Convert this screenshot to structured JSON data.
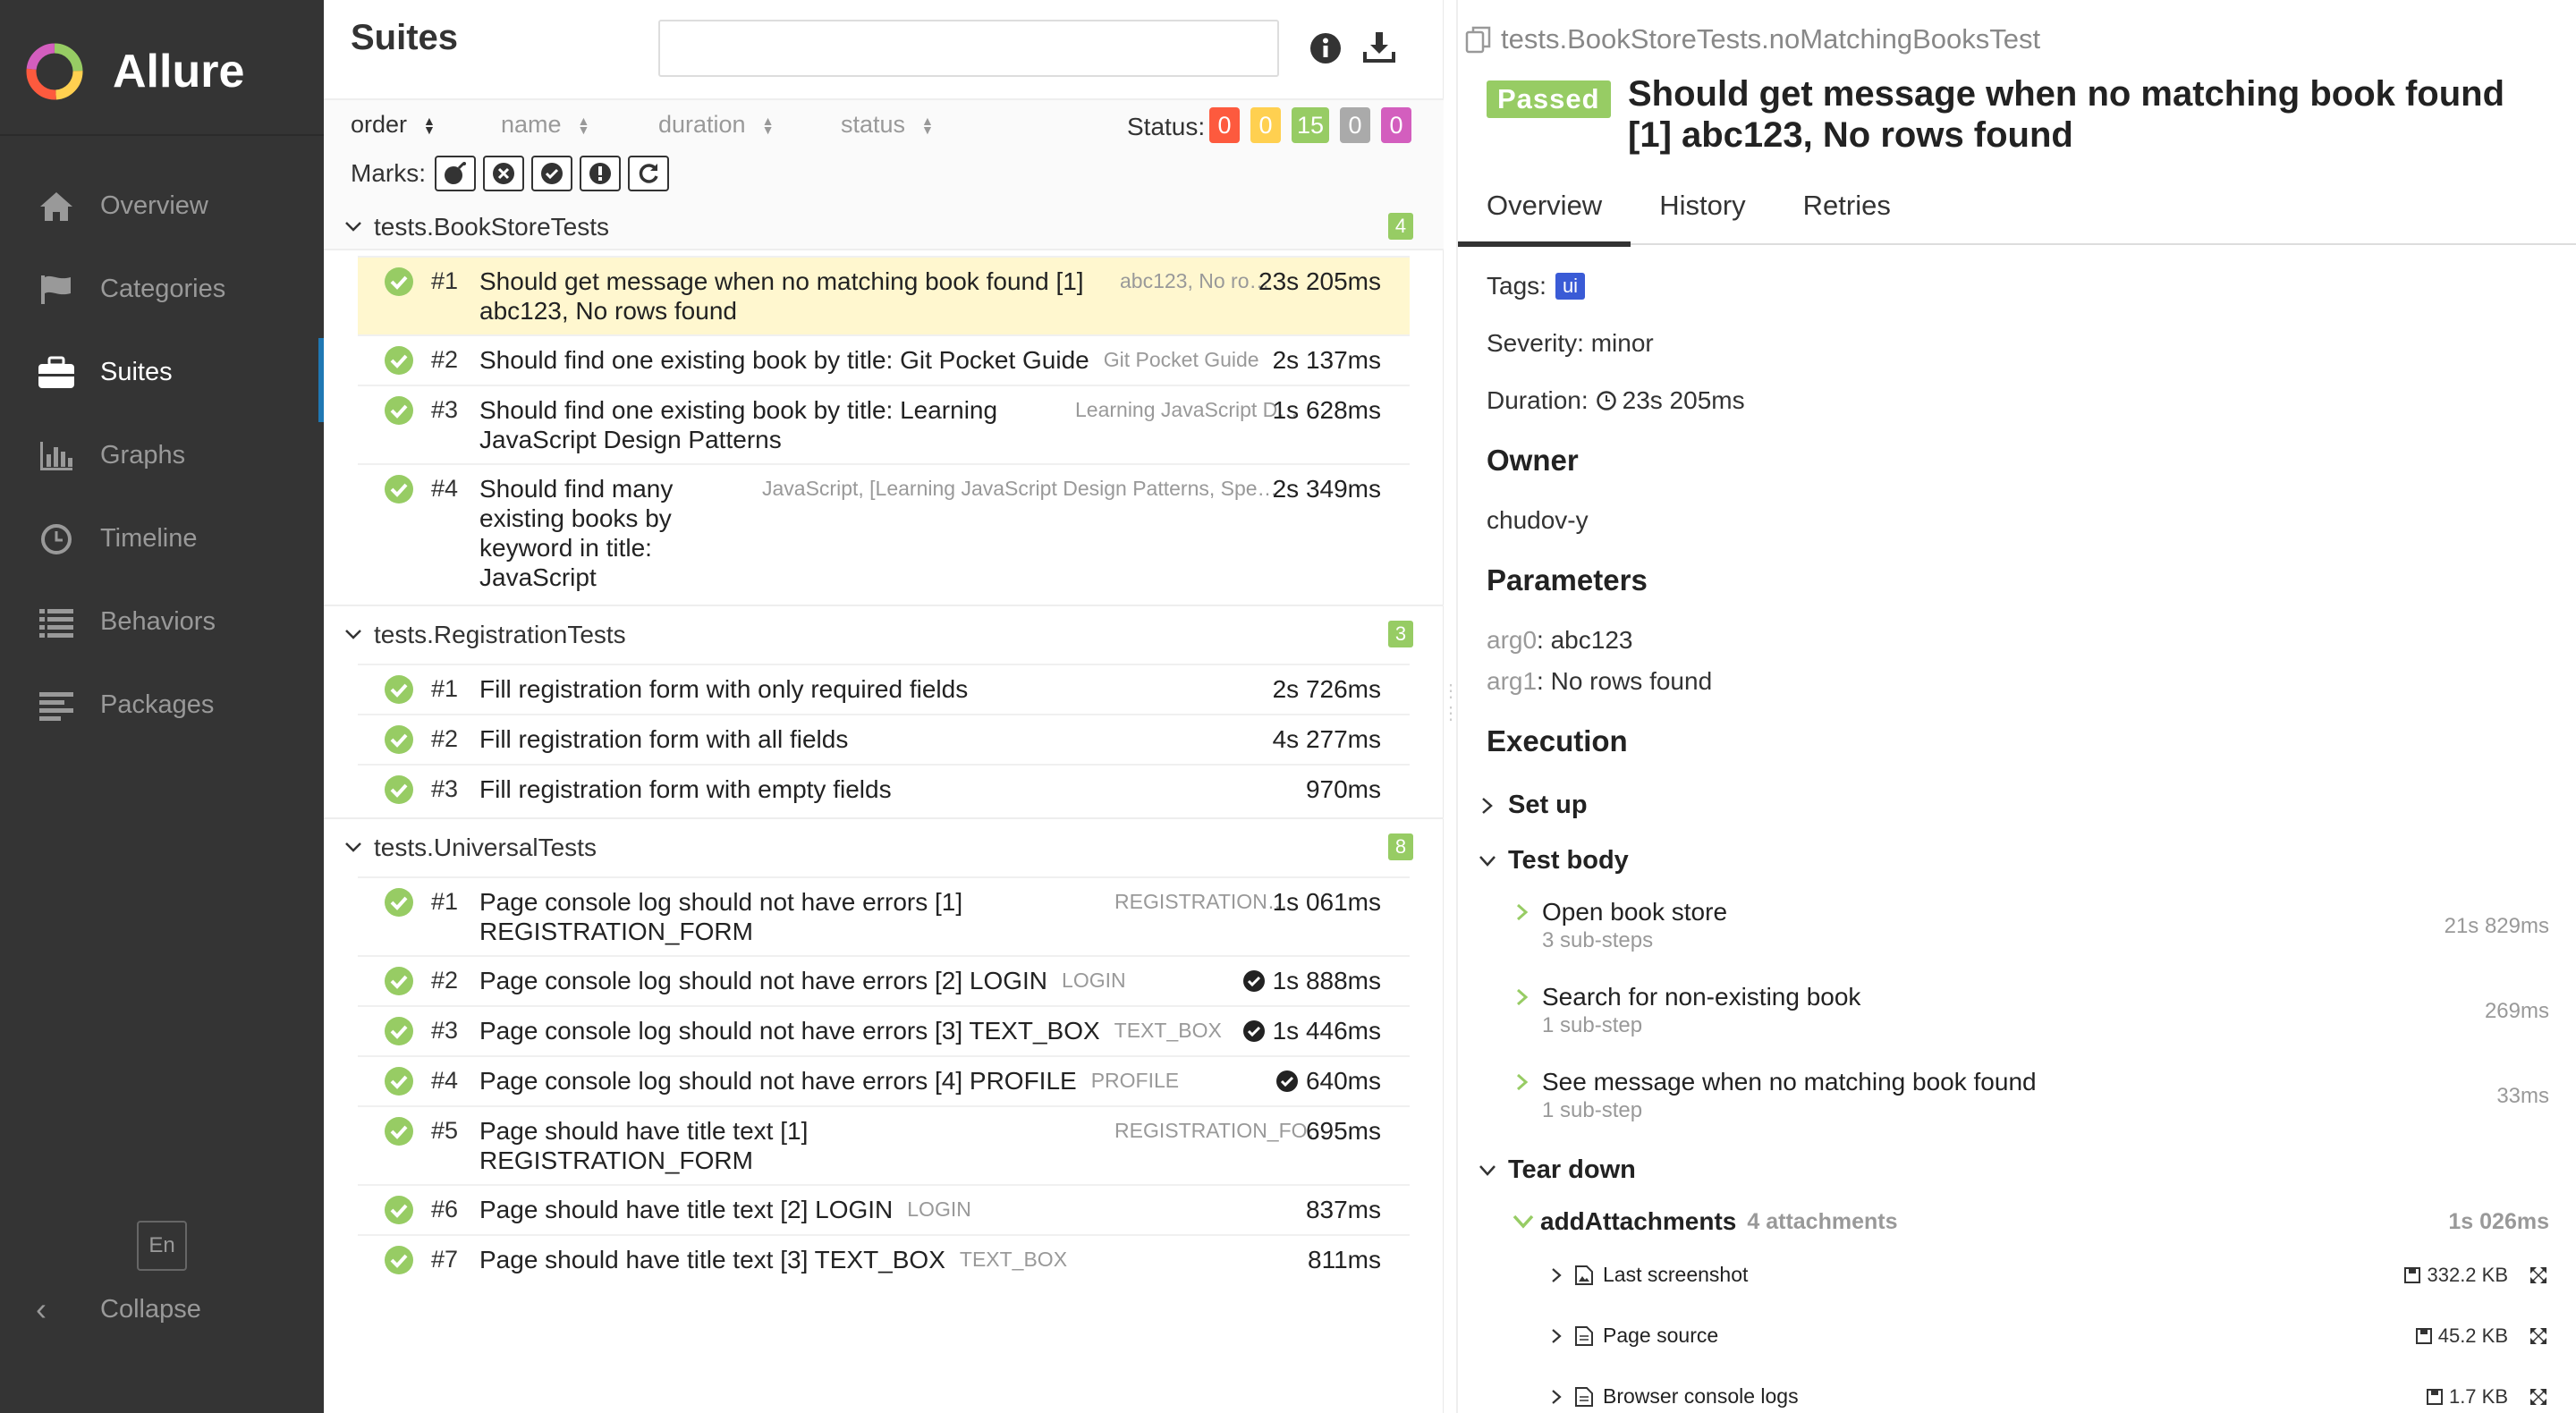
{
  "app": {
    "name": "Allure"
  },
  "sidebar": {
    "items": [
      {
        "label": "Overview",
        "icon": "home-icon"
      },
      {
        "label": "Categories",
        "icon": "flag-icon"
      },
      {
        "label": "Suites",
        "icon": "briefcase-icon",
        "active": true
      },
      {
        "label": "Graphs",
        "icon": "bar-chart-icon"
      },
      {
        "label": "Timeline",
        "icon": "clock-icon"
      },
      {
        "label": "Behaviors",
        "icon": "list-icon"
      },
      {
        "label": "Packages",
        "icon": "align-left-icon"
      }
    ],
    "language": "En",
    "collapse_label": "Collapse"
  },
  "suites": {
    "title": "Suites",
    "search_placeholder": "",
    "sort": {
      "order": "order",
      "name": "name",
      "duration": "duration",
      "status": "status"
    },
    "status_label": "Status:",
    "status_counts": [
      {
        "value": "0",
        "color": "#fd5a3e"
      },
      {
        "value": "0",
        "color": "#ffd050"
      },
      {
        "value": "15",
        "color": "#97cc64"
      },
      {
        "value": "0",
        "color": "#aaaaaa"
      },
      {
        "value": "0",
        "color": "#d35ebe"
      }
    ],
    "marks_label": "Marks:",
    "groups": [
      {
        "name": "tests.BookStoreTests",
        "count": "4",
        "rows": [
          {
            "num": "#1",
            "name": "Should get message when no matching book found [1] abc123, No rows found",
            "param": "abc123, No ro…",
            "duration": "23s 205ms",
            "selected": true
          },
          {
            "num": "#2",
            "name": "Should find one existing book by title: Git Pocket Guide",
            "param": "Git Pocket Guide",
            "duration": "2s 137ms"
          },
          {
            "num": "#3",
            "name": "Should find one existing book by title: Learning JavaScript Design Patterns",
            "param": "Learning JavaScript D…",
            "duration": "1s 628ms"
          },
          {
            "num": "#4",
            "name": "Should find many existing books by keyword in title: JavaScript",
            "param": "JavaScript, [Learning JavaScript Design Patterns, Spe…",
            "duration": "2s 349ms"
          }
        ]
      },
      {
        "name": "tests.RegistrationTests",
        "count": "3",
        "rows": [
          {
            "num": "#1",
            "name": "Fill registration form with only required fields",
            "param": "",
            "duration": "2s 726ms"
          },
          {
            "num": "#2",
            "name": "Fill registration form with all fields",
            "param": "",
            "duration": "4s 277ms"
          },
          {
            "num": "#3",
            "name": "Fill registration form with empty fields",
            "param": "",
            "duration": "970ms"
          }
        ]
      },
      {
        "name": "tests.UniversalTests",
        "count": "8",
        "rows": [
          {
            "num": "#1",
            "name": "Page console log should not have errors [1] REGISTRATION_FORM",
            "param": "REGISTRATION…",
            "duration": "1s 061ms"
          },
          {
            "num": "#2",
            "name": "Page console log should not have errors [2] LOGIN",
            "param": "LOGIN",
            "duration": "1s 888ms",
            "retried": true
          },
          {
            "num": "#3",
            "name": "Page console log should not have errors [3] TEXT_BOX",
            "param": "TEXT_BOX",
            "duration": "1s 446ms",
            "retried": true
          },
          {
            "num": "#4",
            "name": "Page console log should not have errors [4] PROFILE",
            "param": "PROFILE",
            "duration": "640ms",
            "retried": true
          },
          {
            "num": "#5",
            "name": "Page should have title text [1] REGISTRATION_FORM",
            "param": "REGISTRATION_FO…",
            "duration": "695ms"
          },
          {
            "num": "#6",
            "name": "Page should have title text [2] LOGIN",
            "param": "LOGIN",
            "duration": "837ms"
          },
          {
            "num": "#7",
            "name": "Page should have title text [3] TEXT_BOX",
            "param": "TEXT_BOX",
            "duration": "811ms"
          }
        ]
      }
    ]
  },
  "detail": {
    "path": "tests.BookStoreTests.noMatchingBooksTest",
    "status": "Passed",
    "title": "Should get message when no matching book found [1] abc123, No rows found",
    "tabs": [
      "Overview",
      "History",
      "Retries"
    ],
    "tags_label": "Tags:",
    "tag": "ui",
    "severity": "Severity: minor",
    "duration_label": "Duration:",
    "duration": "23s 205ms",
    "owner_heading": "Owner",
    "owner": "chudov-y",
    "params_heading": "Parameters",
    "params": [
      {
        "key": "arg0",
        "value": ": abc123"
      },
      {
        "key": "arg1",
        "value": ": No rows found"
      }
    ],
    "execution_heading": "Execution",
    "setup_label": "Set up",
    "body_label": "Test body",
    "steps": [
      {
        "name": "Open book store",
        "sub": "3 sub-steps",
        "duration": "21s 829ms"
      },
      {
        "name": "Search for non-existing book",
        "sub": "1 sub-step",
        "duration": "269ms"
      },
      {
        "name": "See message when no matching book found",
        "sub": "1 sub-step",
        "duration": "33ms"
      }
    ],
    "teardown_label": "Tear down",
    "add_attachments": {
      "name": "addAttachments",
      "sub": "4 attachments",
      "duration": "1s 026ms"
    },
    "attachments": [
      {
        "name": "Last screenshot",
        "size": "332.2 KB",
        "icon": "image-file-icon"
      },
      {
        "name": "Page source",
        "size": "45.2 KB",
        "icon": "file-icon"
      },
      {
        "name": "Browser console logs",
        "size": "1.7 KB",
        "icon": "file-icon"
      }
    ]
  }
}
